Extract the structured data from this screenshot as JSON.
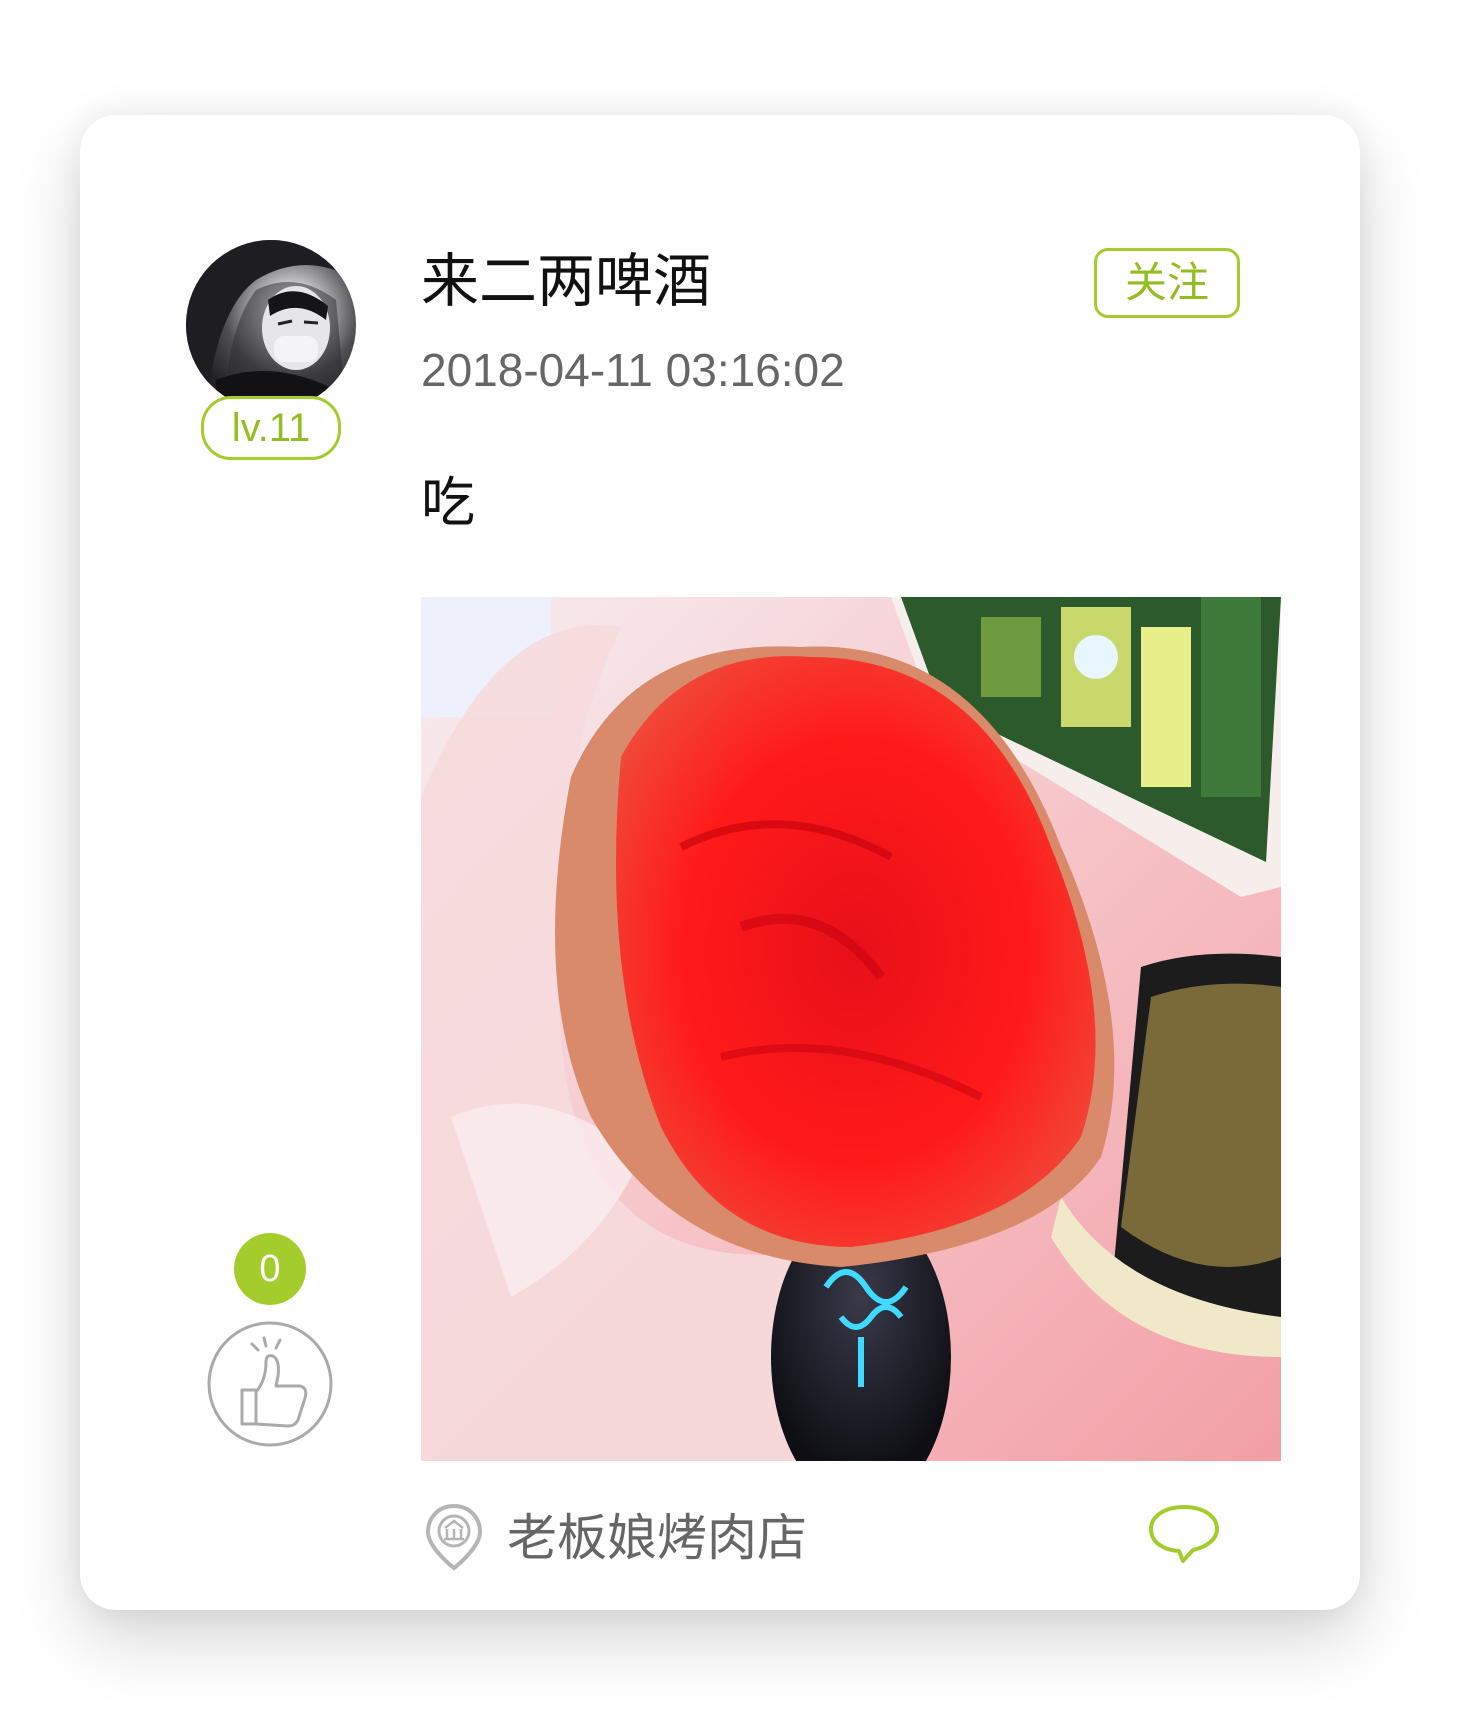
{
  "post": {
    "username": "来二两啤酒",
    "level": "lv.11",
    "follow_label": "关注",
    "timestamp": "2018-04-11 03:16:02",
    "text": "吃",
    "like_count": "0",
    "location": "老板娘烤肉店"
  },
  "colors": {
    "accent": "#a5cc2d",
    "text_primary": "#111111",
    "text_secondary": "#666666"
  },
  "icons": [
    "like-thumb-icon",
    "location-pin-icon",
    "comment-bubble-icon"
  ]
}
